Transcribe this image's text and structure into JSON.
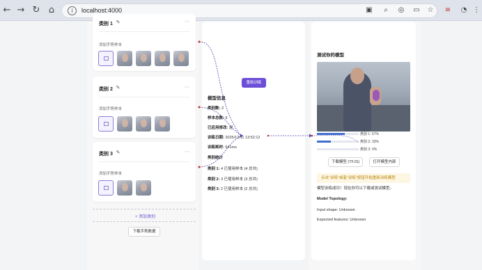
{
  "browser": {
    "url": "localhost:4000",
    "back_icon": "back-arrow-icon",
    "forward_icon": "forward-arrow-icon",
    "reload_icon": "reload-icon",
    "home_icon": "home-icon"
  },
  "classes": [
    {
      "name": "类别 1",
      "add_label": "添加手势样本",
      "thumb_count": 4
    },
    {
      "name": "类别 2",
      "add_label": "添加手势样本",
      "thumb_count": 3
    },
    {
      "name": "类别 3",
      "add_label": "添加手势样本",
      "thumb_count": 2
    }
  ],
  "add_class_label": "+ 添加类别",
  "download_samples_label": "下载手势数据",
  "training": {
    "button_label": "重新训练",
    "info_heading": "模型信息",
    "class_count_label": "类别数:",
    "class_count_value": "3",
    "sample_count_label": "样本总数:",
    "sample_count_value": "9",
    "trained_label": "已应用修改:",
    "trained_value": "是",
    "train_time_label": "训练日期:",
    "train_time_value": "2025/12/11 13:52:12",
    "duration_label": "训练耗时:",
    "duration_value": "541ms",
    "stats_heading": "类别统计",
    "stats": [
      {
        "label": "类别 1:",
        "value": "4 已使用样本 (4 总共)"
      },
      {
        "label": "类别 2:",
        "value": "3 已使用样本 (3 总共)"
      },
      {
        "label": "类别 3:",
        "value": "2 已使用样本 (2 总共)"
      }
    ]
  },
  "preview": {
    "title": "测试你的模型",
    "confidences": [
      {
        "label": "类别 1: 67%",
        "value": 0.67
      },
      {
        "label": "类别 2: 33%",
        "value": 0.33
      },
      {
        "label": "类别 3: 0%",
        "value": 0.0
      }
    ],
    "download_model_label": "下载模型 (TFJS)",
    "open_model_label": "打开模型内部",
    "tip": "点击\"训练\"或者\"训练\"按钮开始重新训练模型",
    "success_text": "模型训练成功！现在你可以下载或测试模型。",
    "topology_label": "Model Topology:",
    "input_shape": "Input shape: Unknown",
    "expected_features": "Expected features: Unknown"
  },
  "colors": {
    "accent": "#6d4fd7",
    "bar": "#3f6fce",
    "arrow": "#4b3aa8"
  }
}
